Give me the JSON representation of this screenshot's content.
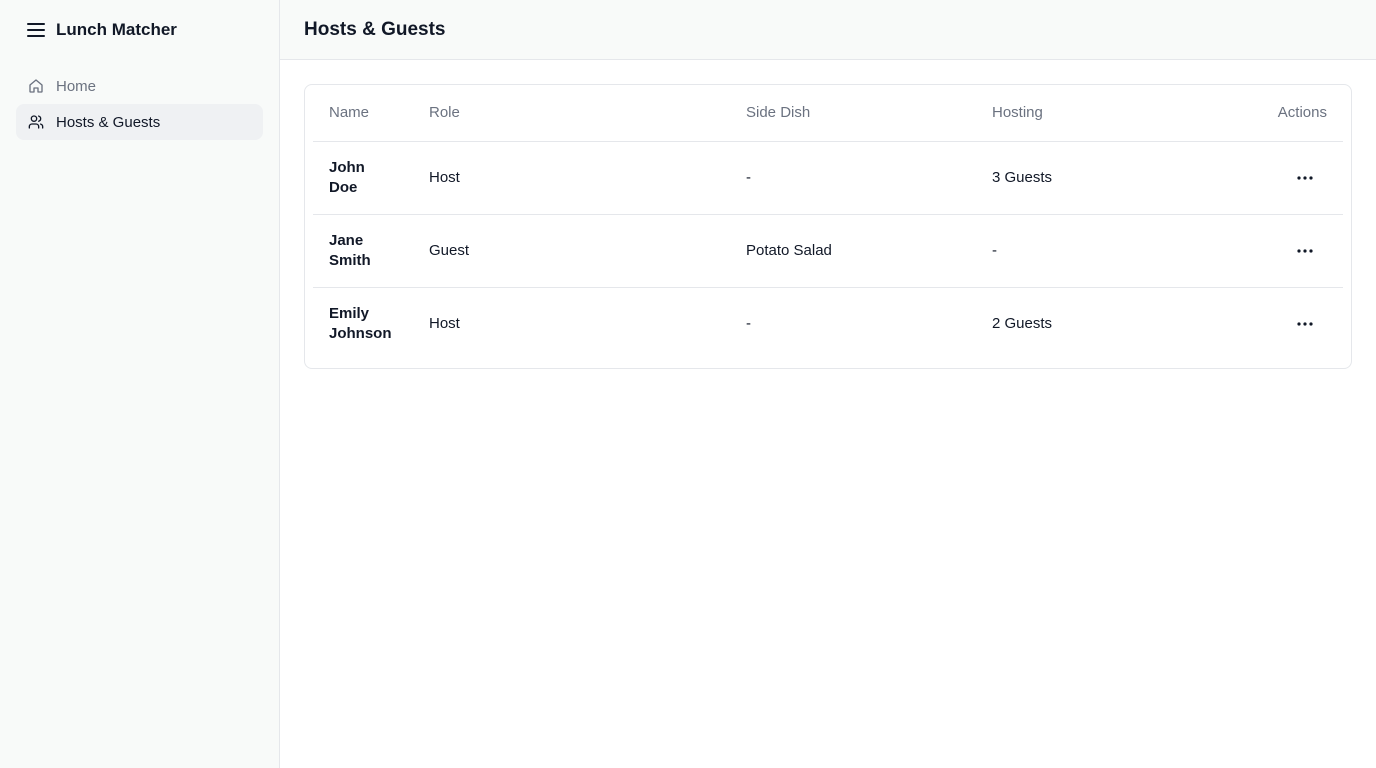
{
  "app": {
    "title": "Lunch Matcher"
  },
  "sidebar": {
    "items": [
      {
        "label": "Home",
        "icon": "home-icon",
        "active": false
      },
      {
        "label": "Hosts & Guests",
        "icon": "users-icon",
        "active": true
      }
    ]
  },
  "header": {
    "title": "Hosts & Guests"
  },
  "table": {
    "columns": [
      "Name",
      "Role",
      "Side Dish",
      "Hosting",
      "Actions"
    ],
    "rows": [
      {
        "name": "John Doe",
        "role": "Host",
        "side_dish": "-",
        "hosting": "3 Guests"
      },
      {
        "name": "Jane Smith",
        "role": "Guest",
        "side_dish": "Potato Salad",
        "hosting": "-"
      },
      {
        "name": "Emily Johnson",
        "role": "Host",
        "side_dish": "-",
        "hosting": "2 Guests"
      }
    ]
  },
  "colors": {
    "sidebar_bg": "#f8faf9",
    "active_item_bg": "#eff1f3",
    "border": "#e5e7eb",
    "muted_text": "#6b7280",
    "text": "#111827"
  }
}
